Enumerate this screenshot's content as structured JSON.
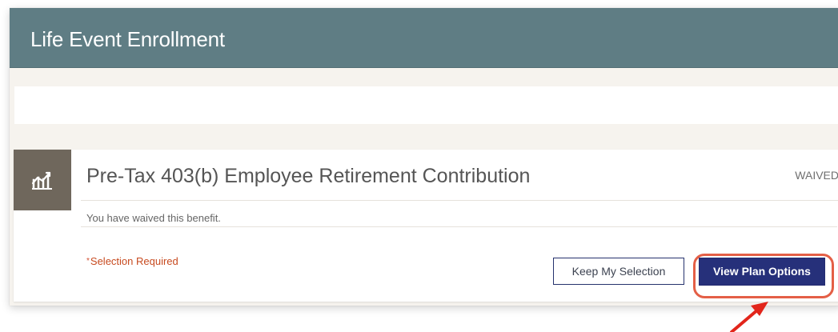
{
  "header": {
    "title": "Life Event Enrollment"
  },
  "benefit": {
    "icon": "chart-icon",
    "title": "Pre-Tax 403(b) Employee Retirement Contribution",
    "status": "WAIVED",
    "message": "You have waived this benefit.",
    "required_marker": "*",
    "required_text": "Selection Required"
  },
  "actions": {
    "keep_selection": "Keep My Selection",
    "view_plan_options": "View Plan Options"
  },
  "colors": {
    "header_bg": "#5F7D84",
    "icon_block": "#6F675C",
    "primary_button": "#26307A",
    "required_text": "#C74A1F",
    "annotation": "#E45F46",
    "arrow": "#E2251B"
  }
}
